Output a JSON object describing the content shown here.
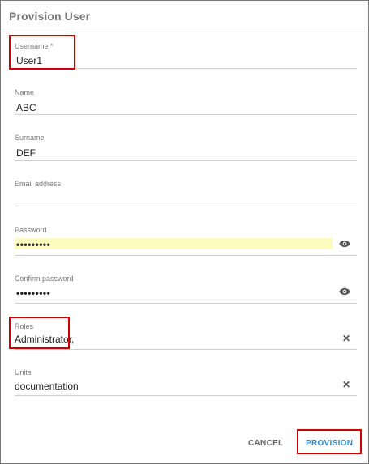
{
  "dialog": {
    "title": "Provision User"
  },
  "fields": {
    "username": {
      "label": "Username *",
      "value": "User1"
    },
    "name": {
      "label": "Name",
      "value": "ABC"
    },
    "surname": {
      "label": "Surname",
      "value": "DEF"
    },
    "email": {
      "label": "Email address",
      "value": ""
    },
    "password": {
      "label": "Password",
      "value": "•••••••••"
    },
    "confirm_password": {
      "label": "Confirm password",
      "value": "•••••••••"
    },
    "roles": {
      "label": "Roles",
      "value": "Administrator,"
    },
    "units": {
      "label": "Units",
      "value": "documentation"
    }
  },
  "icons": {
    "password_visibility": "eye-icon",
    "confirm_visibility": "eye-icon",
    "roles_clear": "close-icon",
    "units_clear": "close-icon"
  },
  "actions": {
    "cancel_label": "CANCEL",
    "provision_label": "PROVISION"
  },
  "colors": {
    "accent": "#2a8bd0",
    "highlight": "#cc0000",
    "autofill": "#fcfcbf"
  }
}
